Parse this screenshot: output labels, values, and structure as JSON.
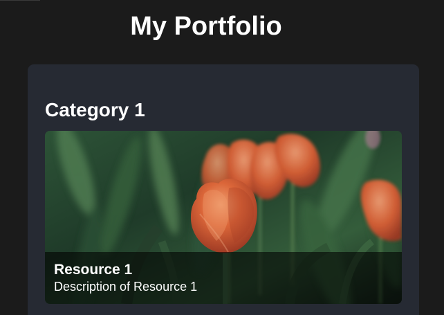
{
  "header": {
    "title": "My Portfolio"
  },
  "categories": [
    {
      "title": "Category 1",
      "resources": [
        {
          "title": "Resource 1",
          "description": "Description of Resource 1",
          "image": "tulips-photo"
        }
      ]
    }
  ],
  "colors": {
    "page_background": "#1b1b1b",
    "panel_background": "#262a33",
    "text": "#ffffff",
    "overlay": "rgba(0,0,0,0.58)"
  }
}
